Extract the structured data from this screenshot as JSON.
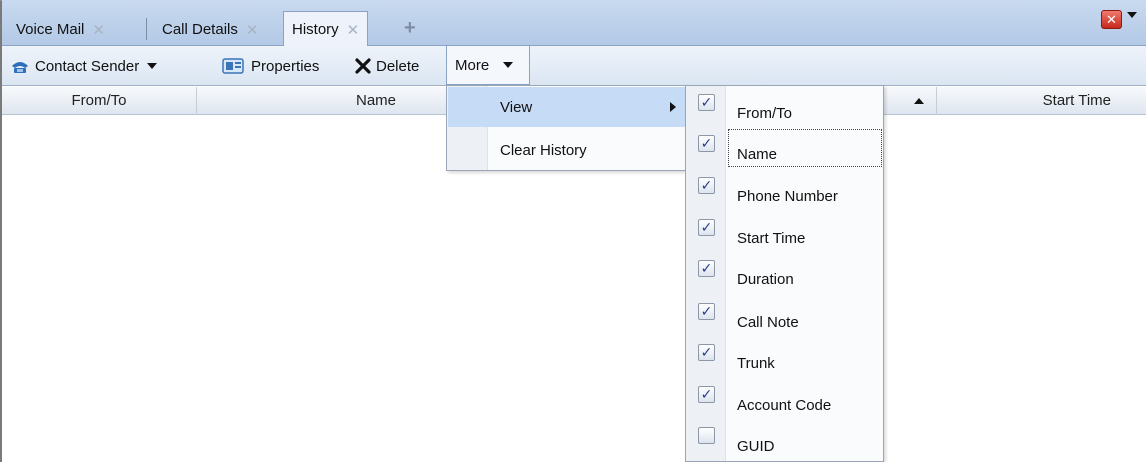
{
  "tabs": [
    {
      "label": "Voice Mail",
      "active": false
    },
    {
      "label": "Call Details",
      "active": false
    },
    {
      "label": "History",
      "active": true
    }
  ],
  "tab_add_glyph": "+",
  "window_close_glyph": "✕",
  "toolbar": {
    "contact_sender_label": "Contact Sender",
    "properties_label": "Properties",
    "delete_label": "Delete",
    "more_label": "More"
  },
  "columns": {
    "from_to": "From/To",
    "name": "Name",
    "start_time": "Start Time"
  },
  "more_menu": {
    "items": [
      {
        "label": "View",
        "has_submenu": true,
        "highlighted": true
      },
      {
        "label": "Clear History",
        "has_submenu": false,
        "highlighted": false
      }
    ]
  },
  "view_submenu": {
    "items": [
      {
        "label": "From/To",
        "checked": true
      },
      {
        "label": "Name",
        "checked": true,
        "focused": true
      },
      {
        "label": "Phone Number",
        "checked": true
      },
      {
        "label": "Start Time",
        "checked": true
      },
      {
        "label": "Duration",
        "checked": true
      },
      {
        "label": "Call Note",
        "checked": true
      },
      {
        "label": "Trunk",
        "checked": true
      },
      {
        "label": "Account Code",
        "checked": true
      },
      {
        "label": "GUID",
        "checked": false
      }
    ]
  },
  "icons": {
    "tab_close": "close-x-icon",
    "contact_sender": "phone-icon",
    "properties": "properties-icon",
    "delete": "delete-x-icon",
    "window_close": "window-close-icon",
    "check": "✓"
  },
  "colors": {
    "tab_strip": "#c9daf0",
    "toolbar": "#e4ecf6",
    "menu_highlight": "#c6dbf6",
    "close_red": "#d9382b",
    "check_blue": "#2a3f8a"
  }
}
